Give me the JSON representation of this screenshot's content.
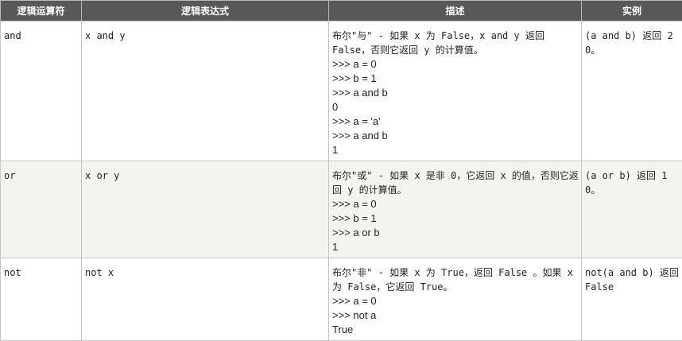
{
  "headers": [
    "逻辑运算符",
    "逻辑表达式",
    "描述",
    "实例"
  ],
  "rows": [
    {
      "operator": "and",
      "expression": "x and y",
      "description": "布尔\"与\" - 如果 x 为 False，x and y 返回 False，否则它返回 y 的计算值。",
      "code": [
        ">>> a = 0",
        ">>> b = 1",
        ">>> a and b"
      ],
      "result1": "0",
      "code2": [
        ">>> a = 'a'",
        ">>> a and b"
      ],
      "result2": "1",
      "example": "(a and b) 返回 20。"
    },
    {
      "operator": "or",
      "expression": "x or y",
      "description": "布尔\"或\" - 如果 x 是非 0，它返回 x 的值，否则它返回 y 的计算值。",
      "code": [
        ">>> a = 0",
        ">>> b = 1",
        ">>> a or b"
      ],
      "result1": "1",
      "example": "(a or b) 返回 10。"
    },
    {
      "operator": "not",
      "expression": "not x",
      "description": "布尔\"非\" - 如果 x 为 True，返回 False 。如果 x 为 False，它返回 True。",
      "code": [
        ">>> a = 0",
        ">>> not a"
      ],
      "result1": "True",
      "example": "not(a and b) 返回 False"
    }
  ]
}
